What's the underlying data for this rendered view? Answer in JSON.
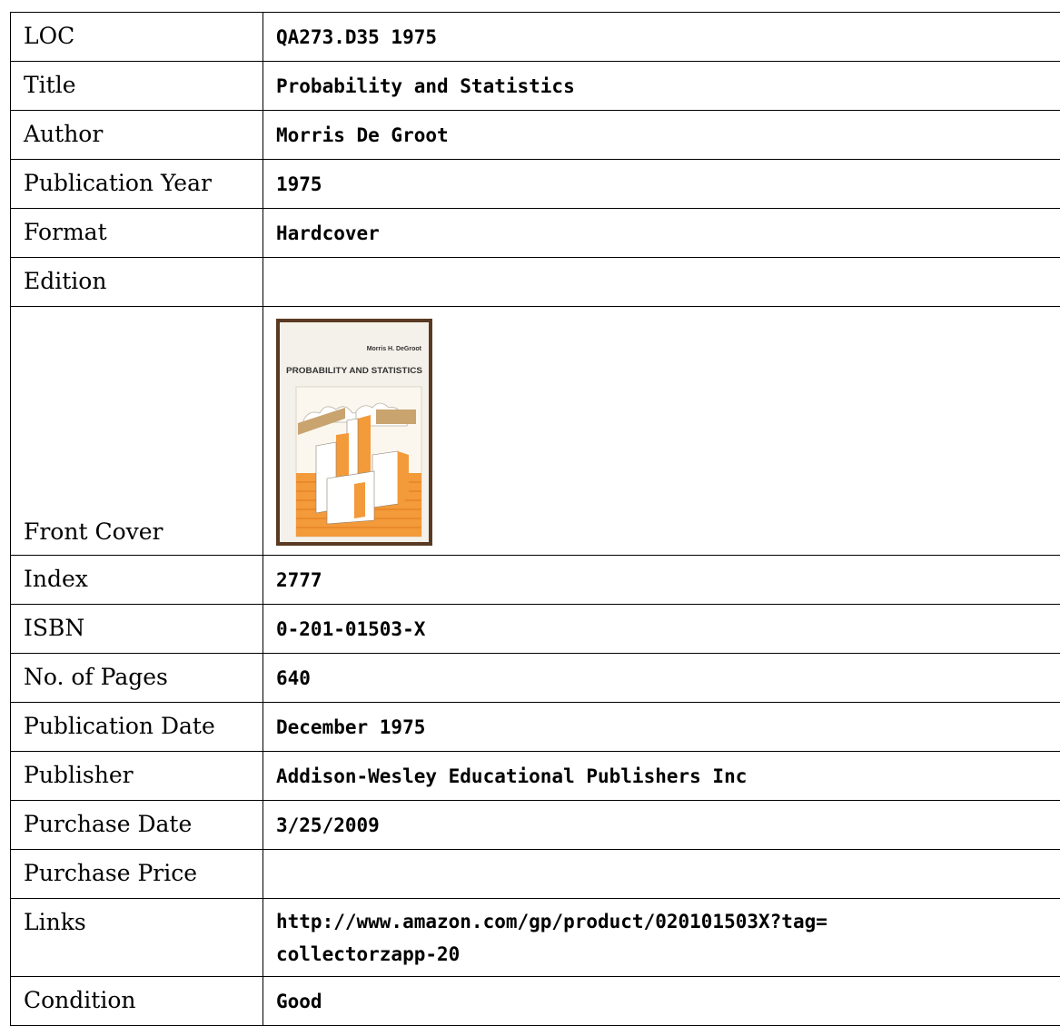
{
  "rows": [
    {
      "label": "LOC",
      "value": "QA273.D35 1975"
    },
    {
      "label": "Title",
      "value": "Probability and Statistics"
    },
    {
      "label": "Author",
      "value": "Morris De Groot"
    },
    {
      "label": "Publication Year",
      "value": "1975"
    },
    {
      "label": "Format",
      "value": "Hardcover"
    },
    {
      "label": "Edition",
      "value": ""
    },
    {
      "label": "Front Cover",
      "value": ""
    },
    {
      "label": "Index",
      "value": "2777"
    },
    {
      "label": "ISBN",
      "value": "0-201-01503-X"
    },
    {
      "label": "No. of Pages",
      "value": "640"
    },
    {
      "label": "Publication Date",
      "value": "December 1975"
    },
    {
      "label": "Publisher",
      "value": "Addison-Wesley Educational Publishers Inc"
    },
    {
      "label": "Purchase Date",
      "value": "3/25/2009"
    },
    {
      "label": "Purchase Price",
      "value": ""
    },
    {
      "label": "Links",
      "value": "http://www.amazon.com/gp/product/020101503X?tag=",
      "value_line2": "collectorzapp-20"
    },
    {
      "label": "Condition",
      "value": "Good"
    }
  ],
  "cover": {
    "author": "Morris H. DeGroot",
    "title": "PROBABILITY AND STATISTICS",
    "colors": {
      "spine_border": "#5a3a22",
      "background": "#f4f1ea",
      "orange": "#f39a3a",
      "dark_orange": "#e07a1a",
      "cloud": "#ffffff"
    }
  }
}
